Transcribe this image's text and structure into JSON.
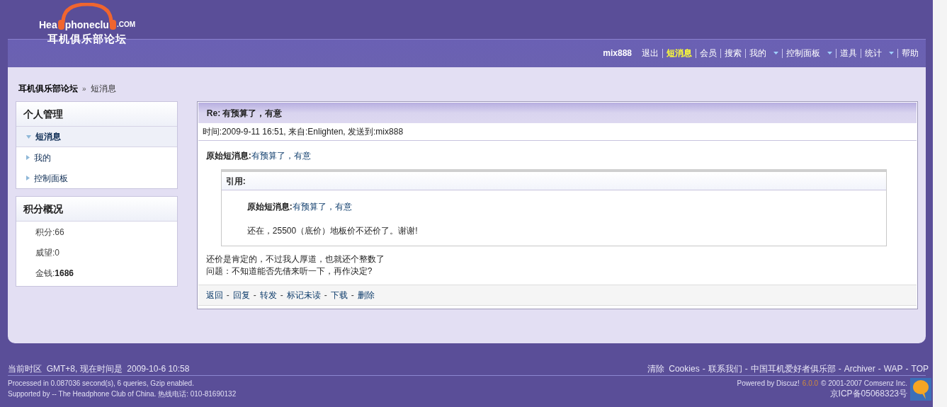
{
  "logo": {
    "wordmark_parts": [
      "Hea",
      "phoneclu",
      ".COM"
    ],
    "subtitle": "耳机俱乐部论坛"
  },
  "nav": {
    "username": "mix888",
    "items": [
      {
        "label": "退出",
        "selected": false,
        "dropdown": false
      },
      {
        "label": "短消息",
        "selected": true,
        "dropdown": false
      },
      {
        "label": "会员",
        "selected": false,
        "dropdown": false
      },
      {
        "label": "搜索",
        "selected": false,
        "dropdown": false
      },
      {
        "label": "我的",
        "selected": false,
        "dropdown": true
      },
      {
        "label": "控制面板",
        "selected": false,
        "dropdown": true
      },
      {
        "label": "道具",
        "selected": false,
        "dropdown": false
      },
      {
        "label": "统计",
        "selected": false,
        "dropdown": true
      },
      {
        "label": "帮助",
        "selected": false,
        "dropdown": false
      }
    ]
  },
  "breadcrumb": {
    "items": [
      "耳机俱乐部论坛",
      "短消息"
    ],
    "separator": "»"
  },
  "sidebar": {
    "personal": {
      "title": "个人管理",
      "items": [
        {
          "label": "短消息",
          "selected": true
        },
        {
          "label": "我的",
          "selected": false
        },
        {
          "label": "控制面板",
          "selected": false
        }
      ]
    },
    "stats": {
      "title": "积分概况",
      "items": [
        {
          "label": "积分:",
          "value": "66",
          "emphasized": false
        },
        {
          "label": "威望:",
          "value": "0",
          "emphasized": false
        },
        {
          "label": "金钱:",
          "value": "1686",
          "emphasized": true
        }
      ]
    }
  },
  "message": {
    "title": "Re: 有预算了，有意",
    "meta": "时间:2009-9-11 16:51, 来自:Enlighten, 发送到:mix888",
    "original": {
      "label": "原始短消息:",
      "link": "有预算了，有意"
    },
    "quote": {
      "title": "引用:",
      "original": {
        "label": "原始短消息:",
        "link": "有预算了，有意"
      },
      "text": "还在，25500（底价）地板价不还价了。谢谢!"
    },
    "body": [
      "还价是肯定的，不过我人厚道，也就还个整数了",
      "问题：不知道能否先借来听一下，再作决定?"
    ],
    "action_separator": "-",
    "actions": [
      "返回",
      "回复",
      "转发",
      "标记未读",
      "下载",
      "删除"
    ]
  },
  "footer": {
    "timezone": "当前时区  GMT+8, 现在时间是  2009-10-6 10:58",
    "link_separator": "-",
    "links": [
      "清除  Cookies",
      "联系我们",
      "中国耳机爱好者俱乐部",
      "Archiver",
      "WAP",
      "TOP"
    ],
    "processed": "Processed in 0.087036 second(s), 6 queries, Gzip enabled.",
    "supported": "Supported by -- The Headphone Club of China. 热线电话: 010-81690132",
    "powered": {
      "prefix": "Powered by Discuz!",
      "version": "6.0.0",
      "suffix": "© 2001-2007 Comsenz Inc."
    },
    "icp": "京ICP备05068323号"
  }
}
